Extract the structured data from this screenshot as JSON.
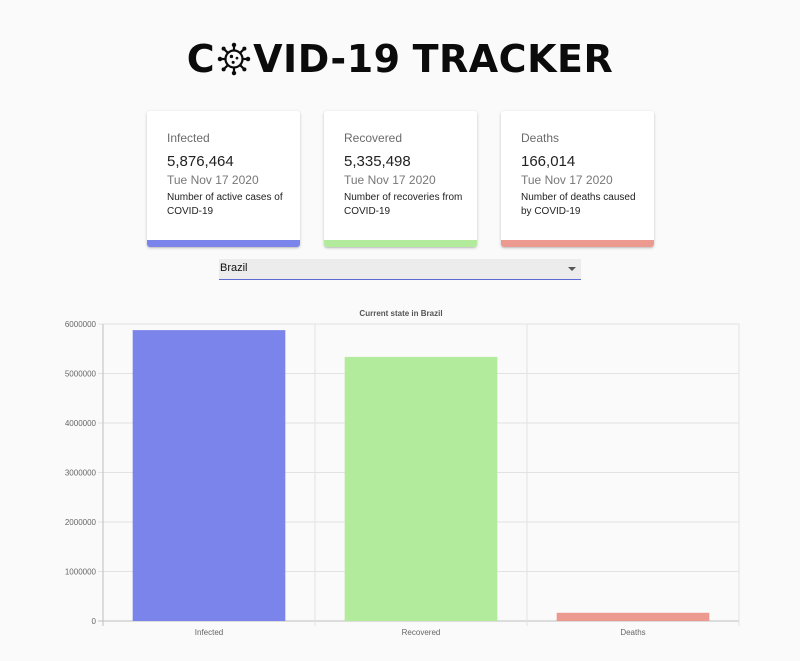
{
  "header": {
    "title_before": "C",
    "title_after_1": "VID-19",
    "title_after_2": "TRACKER",
    "logo_icon": "virus-icon"
  },
  "cards": [
    {
      "label": "Infected",
      "value": "5,876,464",
      "date": "Tue Nov 17 2020",
      "description": "Number of active cases of COVID-19",
      "color": "#7b84ea"
    },
    {
      "label": "Recovered",
      "value": "5,335,498",
      "date": "Tue Nov 17 2020",
      "description": "Number of recoveries from COVID-19",
      "color": "#b1eb9b"
    },
    {
      "label": "Deaths",
      "value": "166,014",
      "date": "Tue Nov 17 2020",
      "description": "Number of deaths caused by COVID-19",
      "color": "#ec9a90"
    }
  ],
  "country_select": {
    "selected": "Brazil",
    "icon": "caret-down-icon",
    "accent_color": "#5b6ad0"
  },
  "chart_data": {
    "type": "bar",
    "title": "Current state in Brazil",
    "categories": [
      "Infected",
      "Recovered",
      "Deaths"
    ],
    "values": [
      5876464,
      5335498,
      166014
    ],
    "colors": [
      "#7b84ea",
      "#b1eb9b",
      "#ec9a90"
    ],
    "ylim": [
      0,
      6000000
    ],
    "yticks": [
      0,
      1000000,
      2000000,
      3000000,
      4000000,
      5000000,
      6000000
    ],
    "ytick_labels": [
      "0",
      "1000000",
      "2000000",
      "3000000",
      "4000000",
      "5000000",
      "6000000"
    ],
    "grid": true,
    "legend": "none"
  }
}
